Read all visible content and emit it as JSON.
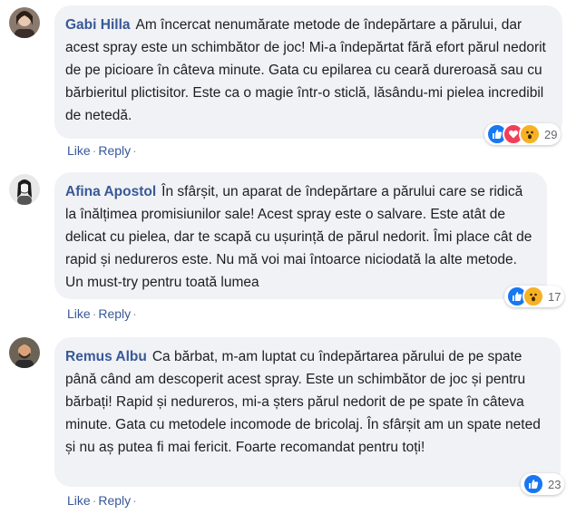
{
  "comments": [
    {
      "author": "Gabi Hilla",
      "text": "Am încercat nenumărate metode de îndepărtare a părului, dar acest spray este un schimbător de joc! Mi-a îndepărtat fără efort părul nedorit de pe picioare în câteva minute. Gata cu epilarea cu ceară dureroasă sau cu bărbieritul plictisitor. Este ca o magie într-o sticlă, lăsându-mi pielea incredibil de netedă.",
      "like_label": "Like",
      "reply_label": "Reply",
      "reactions": [
        "like",
        "love",
        "wow"
      ],
      "reaction_count": "29"
    },
    {
      "author": "Afina Apostol",
      "text": "În sfârșit, un aparat de îndepărtare a părului care se ridică la înălțimea promisiunilor sale! Acest spray este o salvare. Este atât de delicat cu pielea, dar te scapă cu ușurință de părul nedorit. Îmi place cât de rapid și nedureros este. Nu mă voi mai întoarce niciodată la alte metode. Un must-try pentru toată lumea",
      "like_label": "Like",
      "reply_label": "Reply",
      "reactions": [
        "like",
        "wow"
      ],
      "reaction_count": "17"
    },
    {
      "author": "Remus Albu",
      "text": "Ca bărbat, m-am luptat cu îndepărtarea părului de pe spate până când am descoperit acest spray. Este un schimbător de joc și pentru bărbați! Rapid și nedureros, mi-a șters părul nedorit de pe spate în câteva minute. Gata cu metodele incomode de bricolaj. În sfârșit am un spate neted și nu aș putea fi mai fericit. Foarte recomandat pentru toți!",
      "like_label": "Like",
      "reply_label": "Reply",
      "reactions": [
        "like"
      ],
      "reaction_count": "23"
    }
  ],
  "colors": {
    "link": "#385898",
    "bubble": "#f0f2f5",
    "text": "#1c1e21",
    "like": "#1877f2",
    "love": "#f33e58",
    "wow": "#f7b125"
  }
}
